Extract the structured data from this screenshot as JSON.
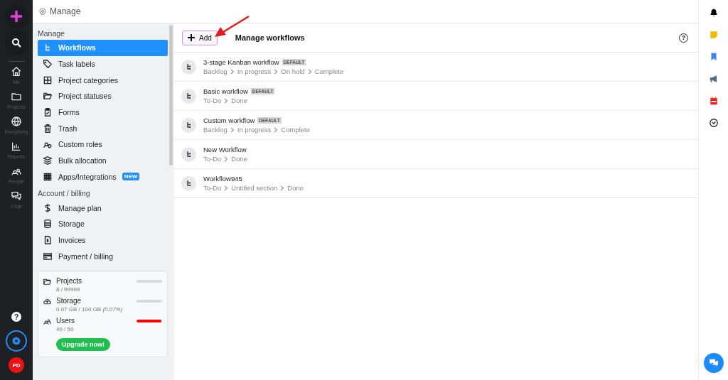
{
  "rail": {
    "nav": [
      {
        "label": "Me"
      },
      {
        "label": "Projects"
      },
      {
        "label": "Everything"
      },
      {
        "label": "Reports"
      },
      {
        "label": "People"
      },
      {
        "label": "Chat"
      }
    ],
    "help": "?",
    "settings_selected": true,
    "avatar": "PD"
  },
  "header": {
    "title": "Manage"
  },
  "sidebar": {
    "sections": [
      {
        "title": "Manage",
        "items": [
          {
            "label": "Workflows",
            "selected": true
          },
          {
            "label": "Task labels",
            "selected": false
          },
          {
            "label": "Project categories",
            "selected": false
          },
          {
            "label": "Project statuses",
            "selected": false
          },
          {
            "label": "Forms",
            "selected": false
          },
          {
            "label": "Trash",
            "selected": false
          },
          {
            "label": "Custom roles",
            "selected": false
          },
          {
            "label": "Bulk allocation",
            "selected": false
          },
          {
            "label": "Apps/Integrations",
            "selected": false,
            "badge": "NEW"
          }
        ]
      },
      {
        "title": "Account / billing",
        "items": [
          {
            "label": "Manage plan",
            "selected": false
          },
          {
            "label": "Storage",
            "selected": false
          },
          {
            "label": "Invoices",
            "selected": false
          },
          {
            "label": "Payment / billing",
            "selected": false
          }
        ]
      }
    ],
    "usage": [
      {
        "label": "Projects",
        "detail": "8 / 99999",
        "level": 0.0
      },
      {
        "label": "Storage",
        "detail": "0.07 GB / 100 GB *(0.07%)*",
        "level": 0.0
      },
      {
        "label": "Users",
        "detail": "49 / 50",
        "level": 0.98
      }
    ],
    "upgrade_button": "Upgrade now!"
  },
  "main": {
    "add_button": "Add",
    "title": "Manage workflows",
    "help": "?",
    "workflows": [
      {
        "name": "3-stage Kanban workflow",
        "badge": "DEFAULT",
        "stages": [
          "Backlog",
          "In progress",
          "On hold",
          "Complete"
        ]
      },
      {
        "name": "Basic workflow",
        "badge": "DEFAULT",
        "stages": [
          "To-Do",
          "Done"
        ]
      },
      {
        "name": "Custom workflow",
        "badge": "DEFAULT",
        "stages": [
          "Backlog",
          "In progress",
          "Complete"
        ]
      },
      {
        "name": "New Workflow",
        "stages": [
          "To-Do",
          "Done"
        ]
      },
      {
        "name": "Workflow945",
        "stages": [
          "To-Do",
          "Untitled section",
          "Done"
        ]
      }
    ]
  }
}
